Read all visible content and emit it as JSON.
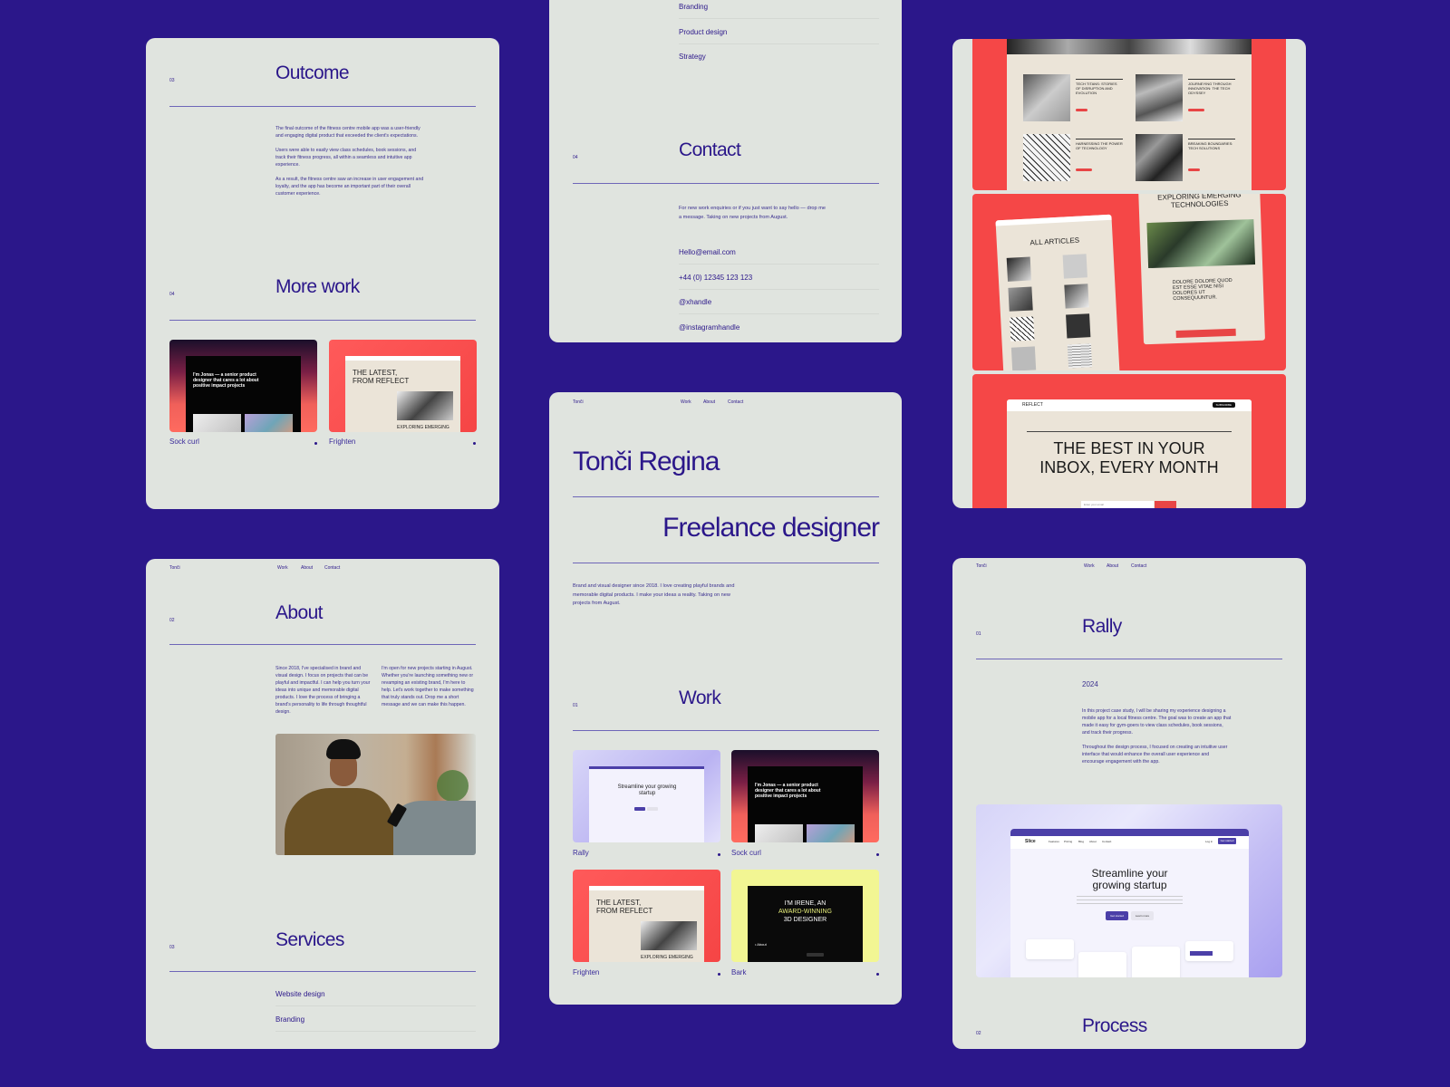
{
  "brand": {
    "name": "Tonči",
    "nav": [
      "Work",
      "About",
      "Contact"
    ],
    "accent": "#2b178a",
    "background": "#2b178a",
    "card": "#e0e4df"
  },
  "outcome_card": {
    "number": "03",
    "title": "Outcome",
    "paragraphs": [
      "The final outcome of the fitness centre mobile app was a user-friendly and engaging digital product that exceeded the client's expectations.",
      "Users were able to easily view class schedules, book sessions, and track their fitness progress, all within a seamless and intuitive app experience.",
      "As a result, the fitness centre saw an increase in user engagement and loyalty, and the app has become an important part of their overall customer experience."
    ],
    "more_number": "04",
    "more_title": "More work",
    "more_items": [
      {
        "label": "Sock curl",
        "preview_text": "I'm Jonas — a senior product designer that cares a lot about positive impact projects"
      },
      {
        "label": "Frighten",
        "preview_title": "THE LATEST, FROM REFLECT",
        "preview_sub": "EXPLORING EMERGING"
      }
    ]
  },
  "about_card": {
    "number": "02",
    "title": "About",
    "col1": "Since 2018, I've specialised in brand and visual design. I focus on projects that can be playful and impactful. I can help you turn your ideas into unique and memorable digital products. I love the process of bringing a brand's personality to life through thoughtful design.",
    "col2": "I'm open for new projects starting in August. Whether you're launching something new or revamping an existing brand, I'm here to help. Let's work together to make something that truly stands out. Drop me a short message and we can make this happen.",
    "services_number": "03",
    "services_title": "Services",
    "services": [
      "Website design",
      "Branding"
    ]
  },
  "contact_card": {
    "services_cont": [
      "Branding",
      "Product design",
      "Strategy"
    ],
    "number": "04",
    "title": "Contact",
    "intro": "For new work enquiries or if you just want to say hello — drop me a message. Taking on new projects from August.",
    "links": [
      "Hello@email.com",
      "+44 (0) 12345 123 123",
      "@xhandle",
      "@instagramhandle"
    ]
  },
  "home_card": {
    "name": "Tonči Regina",
    "role": "Freelance designer",
    "intro": "Brand and visual designer since 2018. I love creating playful brands and memorable digital products. I make your ideas a reality. Taking on new projects from August.",
    "work_number": "01",
    "work_title": "Work",
    "projects": [
      {
        "label": "Rally",
        "preview_title": "Streamline your growing startup"
      },
      {
        "label": "Sock curl",
        "preview_text": "I'm Jonas — a senior product designer that cares a lot about positive impact projects"
      },
      {
        "label": "Frighten",
        "preview_title": "THE LATEST, FROM REFLECT",
        "preview_sub": "EXPLORING EMERGING"
      },
      {
        "label": "Bark",
        "preview_l1": "I'M IRENE, AN",
        "preview_l2": "AWARD-WINNING",
        "preview_l3": "3D DESIGNER",
        "preview_link": "• About"
      }
    ]
  },
  "reflect_card": {
    "articles": [
      "TECH TITANS: STORIES OF DISRUPTION AND EVOLUTION",
      "JOURNEYING THROUGH INNOVATION: THE TECH ODYSSEY",
      "HARNESSING THE POWER OF TECHNOLOGY",
      "BREAKING BOUNDARIES: TECH SOLUTIONS"
    ],
    "all_articles": "ALL ARTICLES",
    "exploring": "EXPLORING EMERGING TECHNOLOGIES",
    "dolore": "DOLORE DOLORE QUOD EST ESSE VITAE NISI DOLORES UT CONSEQUUNTUR.",
    "logo": "REFLECT",
    "subscribe": "SUBSCRIBE",
    "hero": "THE BEST IN YOUR INBOX, EVERY MONTH",
    "email_placeholder": "Enter your email"
  },
  "rally_card": {
    "number": "01",
    "title": "Rally",
    "year": "2024",
    "paragraphs": [
      "In this project case study, I will be sharing my experience designing a mobile app for a local fitness centre. The goal was to create an app that made it easy for gym-goers to view class schedules, book sessions, and track their progress.",
      "Throughout the design process, I focused on creating an intuitive user interface that would enhance the overall user experience and encourage engagement with the app."
    ],
    "preview_logo": "Slice",
    "preview_nav": [
      "Features",
      "Pricing",
      "Blog",
      "About",
      "Contact"
    ],
    "preview_login": "Log in",
    "preview_cta": "Get started",
    "preview_title": "Streamline your growing startup",
    "preview_btn1": "Get started",
    "preview_btn2": "Learn more",
    "process_number": "02",
    "process_title": "Process"
  }
}
